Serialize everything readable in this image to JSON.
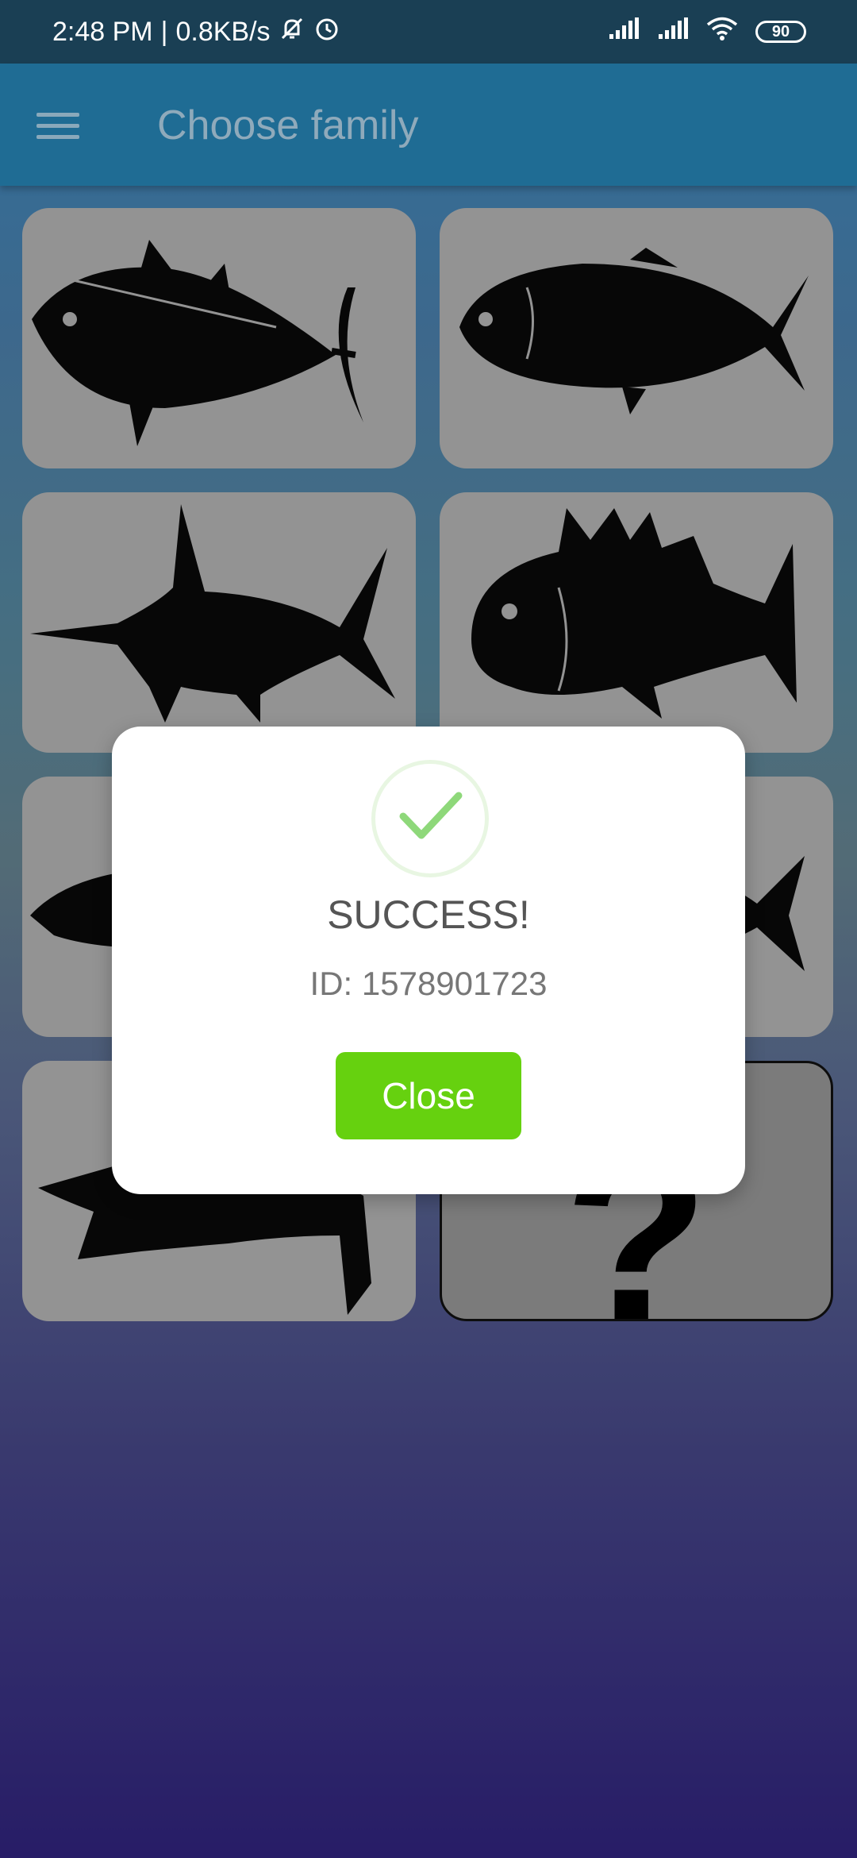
{
  "status_bar": {
    "time": "2:48 PM",
    "separator": "|",
    "net_speed": "0.8KB/s",
    "battery": "90",
    "icons": [
      "bell-off-icon",
      "alarm-icon",
      "signal-icon",
      "signal-icon",
      "wifi-icon",
      "battery-icon"
    ]
  },
  "app_bar": {
    "title": "Choose family",
    "menu_icon": "hamburger-menu-icon"
  },
  "grid": {
    "tiles": [
      {
        "icon": "tuna-icon"
      },
      {
        "icon": "grouper-fish-icon"
      },
      {
        "icon": "marlin-icon"
      },
      {
        "icon": "snapper-fish-icon"
      },
      {
        "icon": "shark-icon"
      },
      {
        "icon": "fish-icon"
      },
      {
        "icon": "ray-icon"
      },
      {
        "icon": "unknown-icon",
        "label": "?"
      }
    ]
  },
  "dialog": {
    "icon": "checkmark-icon",
    "title": "SUCCESS!",
    "message": "ID: 1578901723",
    "close_label": "Close"
  },
  "colors": {
    "status_bar": "#1a3f54",
    "app_bar": "#1f6c94",
    "success_green": "#66d10f",
    "check_green": "#8ed87a"
  }
}
